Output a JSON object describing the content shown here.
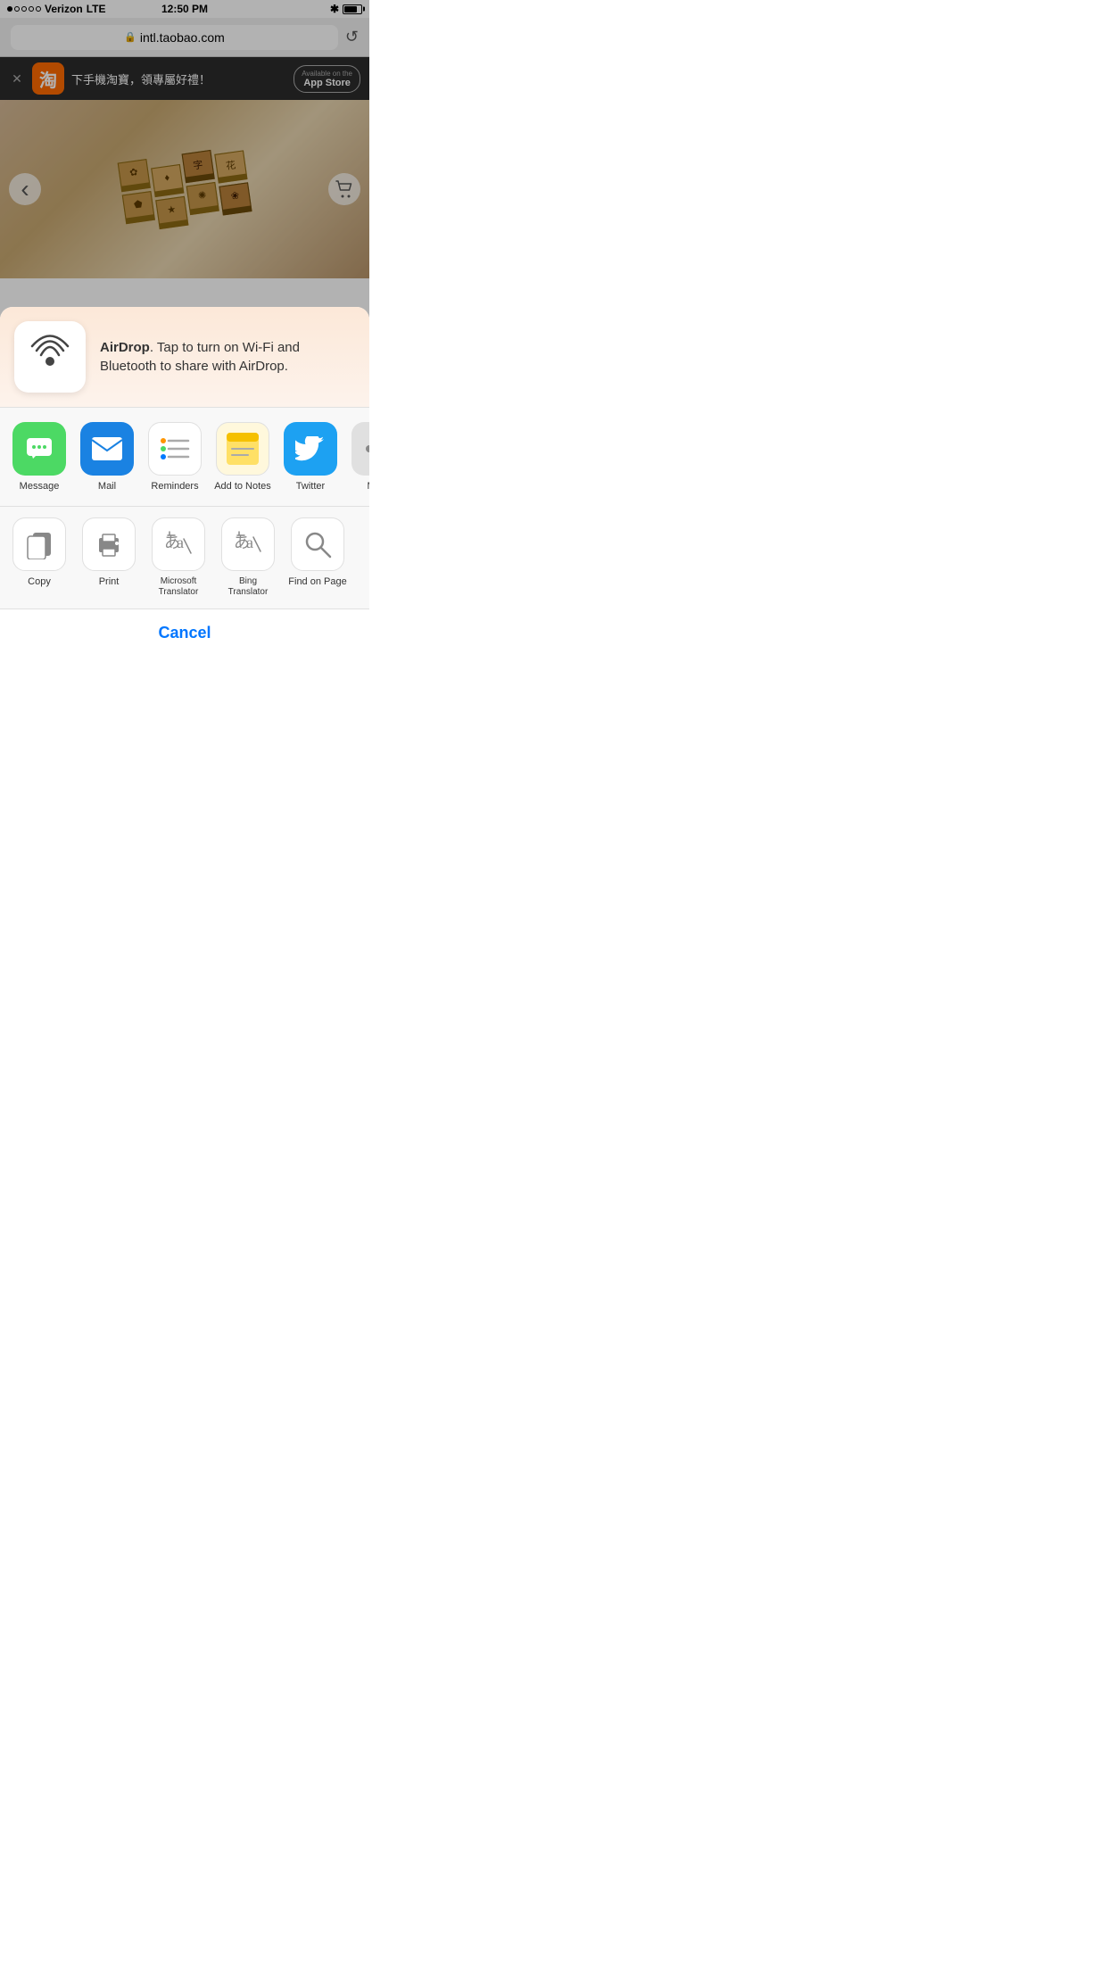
{
  "statusBar": {
    "carrier": "Verizon",
    "network": "LTE",
    "time": "12:50 PM",
    "battery": 80
  },
  "browser": {
    "url": "intl.taobao.com",
    "refreshLabel": "↺"
  },
  "banner": {
    "closeLabel": "✕",
    "appName": "淘",
    "promoText": "下手機淘寶，領專屬好禮！",
    "appStoreSmall": "Available on the",
    "appStoreLarge": "App Store"
  },
  "backButton": "‹",
  "cartButton": "🛒",
  "shareSheet": {
    "airdrop": {
      "title": "AirDrop",
      "description": ". Tap to turn on Wi-Fi and Bluetooth to share with AirDrop."
    },
    "apps": [
      {
        "id": "message",
        "label": "Message",
        "icon": "💬",
        "bg": "message"
      },
      {
        "id": "mail",
        "label": "Mail",
        "icon": "✉️",
        "bg": "mail"
      },
      {
        "id": "reminders",
        "label": "Reminders",
        "icon": "reminders-svg",
        "bg": "reminders"
      },
      {
        "id": "add-to-notes",
        "label": "Add to Notes",
        "icon": "notes-svg",
        "bg": "notes"
      },
      {
        "id": "twitter",
        "label": "Twitter",
        "icon": "🐦",
        "bg": "twitter"
      }
    ],
    "actions": [
      {
        "id": "copy",
        "label": "Copy",
        "icon": "copy"
      },
      {
        "id": "print",
        "label": "Print",
        "icon": "print"
      },
      {
        "id": "microsoft-translator",
        "label": "Microsoft\nTranslator",
        "icon": "translate-ms"
      },
      {
        "id": "bing-translator",
        "label": "Bing\nTranslator",
        "icon": "translate-bing"
      },
      {
        "id": "find-on-page",
        "label": "Find on Page",
        "icon": "search"
      }
    ],
    "cancelLabel": "Cancel"
  }
}
